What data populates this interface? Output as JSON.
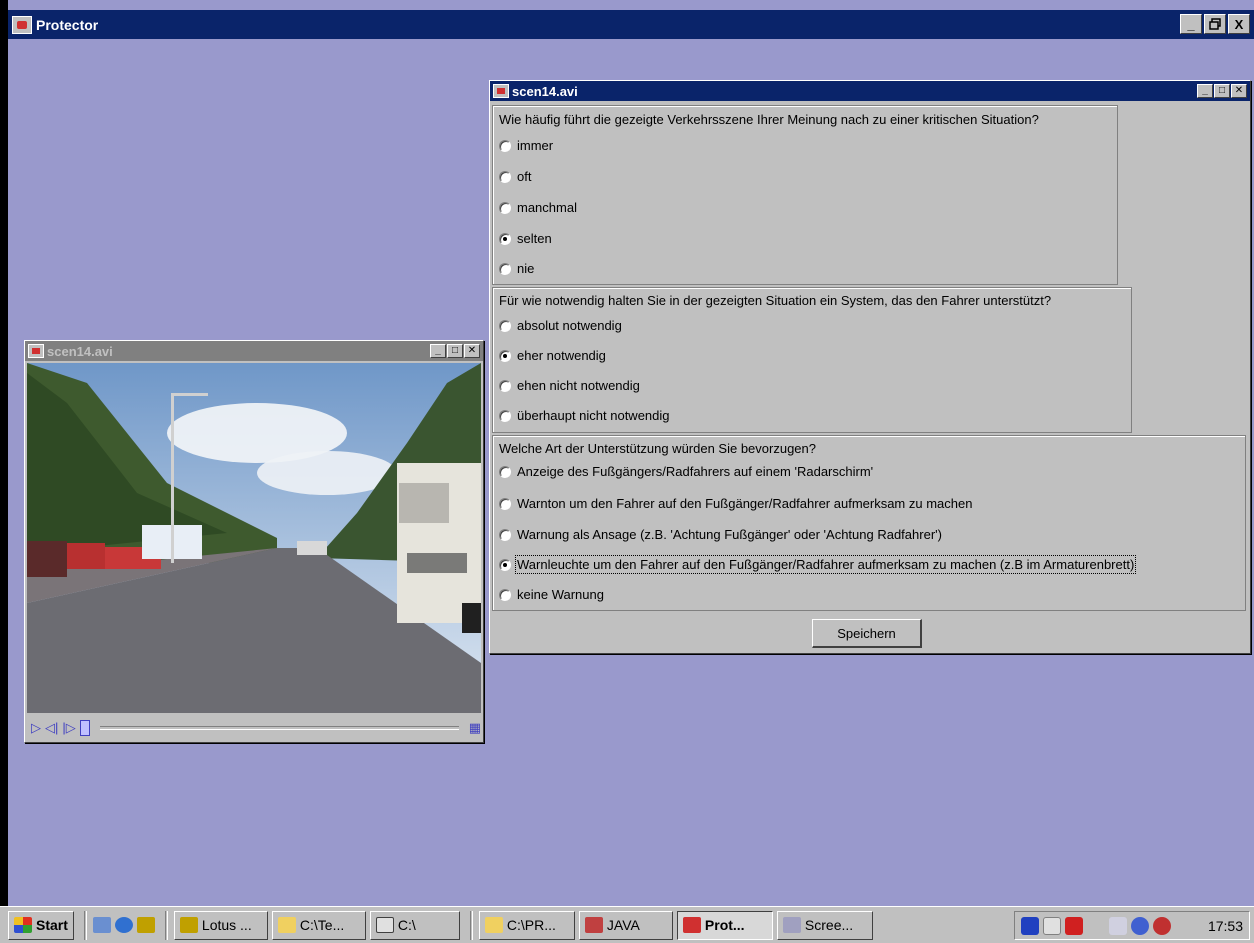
{
  "app": {
    "title": "Protector",
    "controls": {
      "minimize": "_",
      "restore": "ȧ",
      "close": "X"
    }
  },
  "question_window": {
    "title": "scen14.avi",
    "questions": [
      {
        "text": "Wie häufig führt die gezeigte Verkehrsszene Ihrer Meinung nach zu einer kritischen Situation?",
        "options": [
          {
            "label": "immer",
            "selected": false
          },
          {
            "label": "oft",
            "selected": false
          },
          {
            "label": "manchmal",
            "selected": false
          },
          {
            "label": "selten",
            "selected": true
          },
          {
            "label": "nie",
            "selected": false
          }
        ]
      },
      {
        "text": "Für wie notwendig halten Sie in der gezeigten Situation ein System, das den Fahrer unterstützt?",
        "options": [
          {
            "label": "absolut notwendig",
            "selected": false
          },
          {
            "label": "eher notwendig",
            "selected": true
          },
          {
            "label": "ehen nicht notwendig",
            "selected": false
          },
          {
            "label": "überhaupt nicht notwendig",
            "selected": false
          }
        ]
      },
      {
        "text": "Welche Art der Unterstützung würden Sie bevorzugen?",
        "options": [
          {
            "label": "Anzeige des Fußgängers/Radfahrers auf einem 'Radarschirm'",
            "selected": false
          },
          {
            "label": "Warnton um den Fahrer auf den Fußgänger/Radfahrer aufmerksam zu machen",
            "selected": false
          },
          {
            "label": "Warnung als Ansage (z.B. 'Achtung Fußgänger' oder 'Achtung Radfahrer')",
            "selected": false
          },
          {
            "label": "Warnleuchte um den Fahrer auf den Fußgänger/Radfahrer aufmerksam zu machen (z.B im Armaturenbrett)",
            "selected": true
          },
          {
            "label": "keine Warnung",
            "selected": false
          }
        ]
      }
    ],
    "save_label": "Speichern"
  },
  "video_window": {
    "title": "scen14.avi",
    "playback_position": 0,
    "control_icons": [
      "play-icon",
      "step-back-icon",
      "step-forward-icon",
      "film-icon"
    ]
  },
  "taskbar": {
    "start_label": "Start",
    "quick_launch": [
      "desktop-icon",
      "ie-icon",
      "lotus-icon"
    ],
    "items": [
      {
        "label": "Lotus ...",
        "icon": "lotus-icon",
        "pressed": false
      },
      {
        "label": "C:\\Te...",
        "icon": "folder-icon",
        "pressed": false
      },
      {
        "label": "C:\\",
        "icon": "drive-icon",
        "pressed": false
      },
      {
        "label": "C:\\PR...",
        "icon": "folder-icon",
        "pressed": false
      },
      {
        "label": "JAVA",
        "icon": "java-icon",
        "pressed": false
      },
      {
        "label": "Prot...",
        "icon": "java-app-icon",
        "pressed": true
      },
      {
        "label": "Scree...",
        "icon": "screen-icon",
        "pressed": false
      }
    ],
    "clock": "17:53"
  },
  "colors": {
    "desktop": "#9999cc",
    "active_title": "#0a246a",
    "inactive_title": "#808080",
    "face": "#c0c0c0"
  }
}
